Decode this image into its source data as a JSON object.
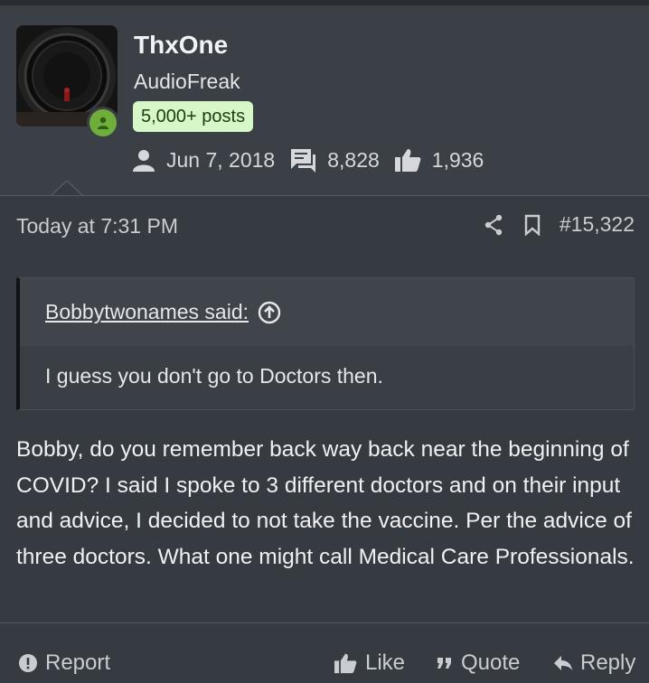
{
  "user": {
    "name": "ThxOne",
    "title": "AudioFreak",
    "badge": "5,000+ posts",
    "joined": "Jun 7, 2018",
    "messages": "8,828",
    "reactions": "1,936"
  },
  "post": {
    "date": "Today at 7:31 PM",
    "number": "#15,322",
    "quote": {
      "author": "Bobbytwonames said:",
      "text": "I guess you don't go to Doctors then."
    },
    "body": "Bobby, do you remember back way back near the beginning of COVID? I said I spoke to 3 different doctors and on their input and advice, I decided to not take the vaccine. Per the advice of three doctors. What one might call Medical Care Professionals."
  },
  "footer": {
    "report": "Report",
    "like": "Like",
    "quote": "Quote",
    "reply": "Reply"
  },
  "colors": {
    "background": "#363a41",
    "online": "#6fae3b",
    "badge": "#d6f7c7"
  }
}
